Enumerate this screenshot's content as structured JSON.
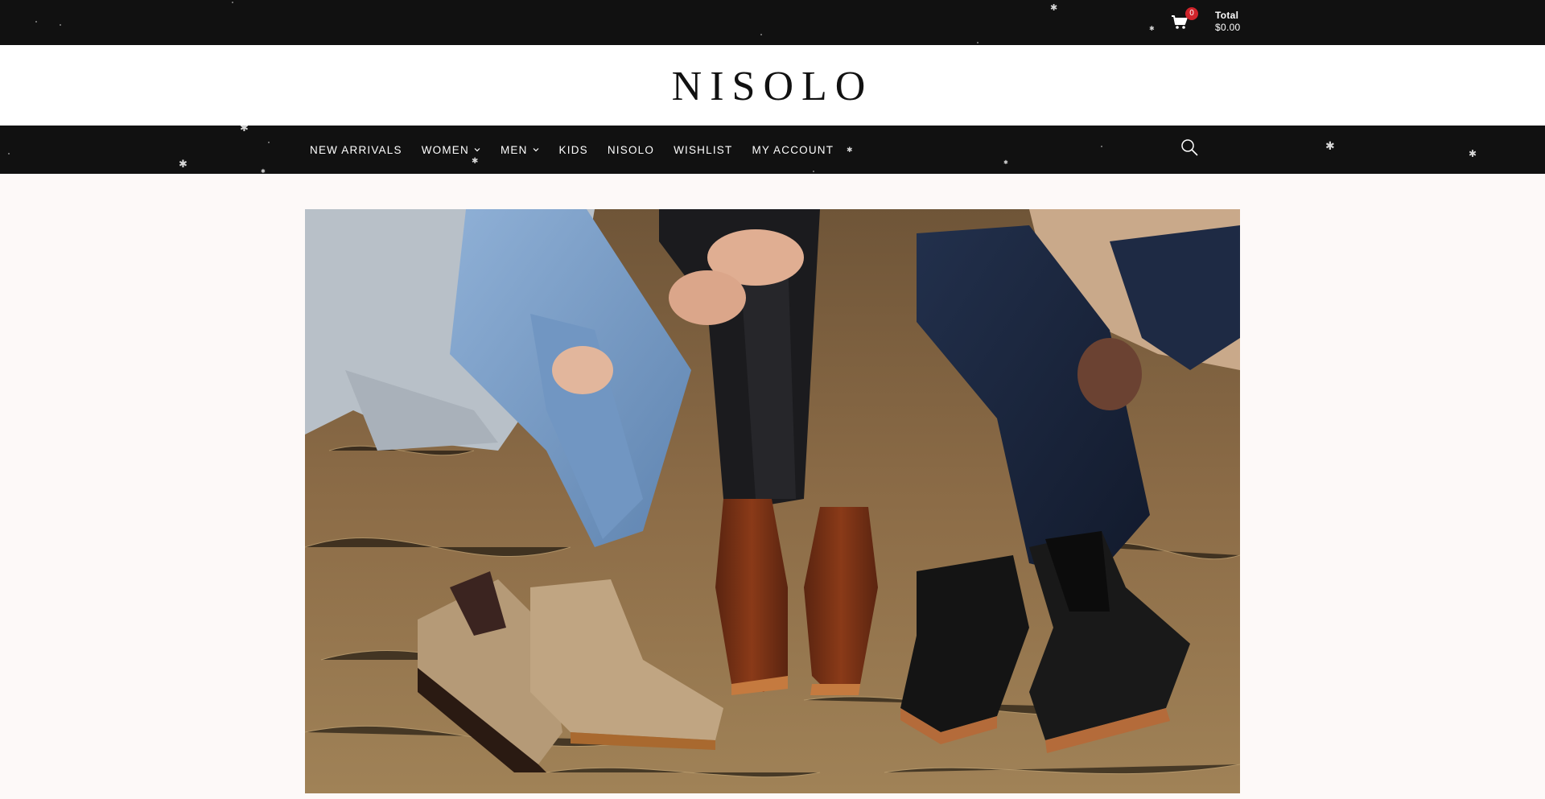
{
  "header": {
    "cart": {
      "count": "0",
      "total_label": "Total",
      "total_value": "$0.00",
      "icon": "cart-icon"
    }
  },
  "brand": {
    "logo_text": "NISOLO"
  },
  "nav": {
    "items": [
      {
        "label": "NEW ARRIVALS",
        "has_dropdown": false
      },
      {
        "label": "WOMEN",
        "has_dropdown": true
      },
      {
        "label": "MEN",
        "has_dropdown": true
      },
      {
        "label": "KIDS",
        "has_dropdown": false
      },
      {
        "label": "NISOLO",
        "has_dropdown": false
      },
      {
        "label": "WISHLIST",
        "has_dropdown": false
      },
      {
        "label": "MY ACCOUNT",
        "has_dropdown": false
      }
    ],
    "search_icon": "search-icon",
    "dropdown_icon": "chevron-down-icon"
  },
  "hero": {
    "image_subject": "three people seated on dry grass wearing chelsea boots in tan suede, brown leather and black leather"
  },
  "colors": {
    "bar_bg": "#111111",
    "page_bg": "#fdf9f8",
    "badge": "#d0242b",
    "text_light": "#ffffff",
    "logo_text": "#111111"
  }
}
